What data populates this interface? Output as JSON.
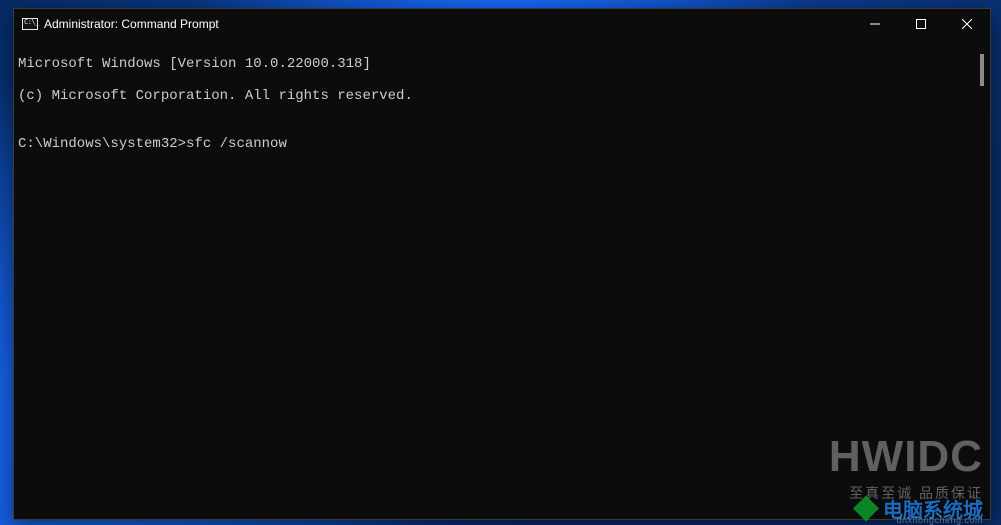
{
  "window": {
    "title": "Administrator: Command Prompt",
    "icon_name": "cmd-icon"
  },
  "terminal": {
    "line1": "Microsoft Windows [Version 10.0.22000.318]",
    "line2": "(c) Microsoft Corporation. All rights reserved.",
    "blank": "",
    "prompt": "C:\\Windows\\system32>",
    "command": "sfc /scannow"
  },
  "watermark": {
    "brand": "HWIDC",
    "tagline": "至真至诚 品质保证",
    "site_cn": "电脑系统城",
    "site_url": "dnxitongcheng.com"
  }
}
